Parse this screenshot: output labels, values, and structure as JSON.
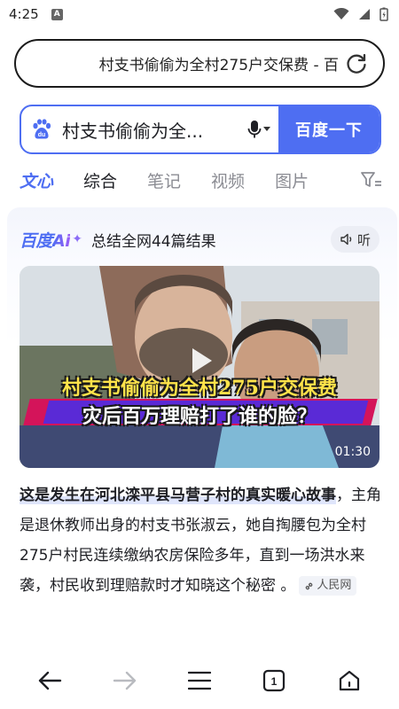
{
  "status": {
    "time": "4:25",
    "notif_letter": "A"
  },
  "address_bar": {
    "url_text": "村支书偷偷为全村275户交保费 - 百"
  },
  "search": {
    "query": "村支书偷偷为全...",
    "submit_label": "百度一下"
  },
  "tabs": [
    {
      "label": "文心"
    },
    {
      "label": "综合"
    },
    {
      "label": "笔记"
    },
    {
      "label": "视频"
    },
    {
      "label": "图片"
    }
  ],
  "ai_card": {
    "logo_text": "百度",
    "logo_ai": "Ai",
    "summary": "总结全网44篇结果",
    "listen_label": "听",
    "video": {
      "caption_line1": "村支书偷偷为全村275户交保费",
      "caption_line2": "灾后百万理赔打了谁的脸？",
      "duration": "01:30"
    },
    "body_highlight": "这是发生在河北滦平县马营子村的真实暖心故事",
    "body_rest": "，主角是退休教师出身的村支书张淑云，她自掏腰包为全村275户村民连续缴纳农房保险多年，直到一场洪水来袭，村民收到理赔款时才知晓这个秘密 。",
    "source": "人民网"
  },
  "colors": {
    "accent": "#4e6ef2",
    "text": "#1e1f24",
    "muted": "#8b8c93"
  }
}
